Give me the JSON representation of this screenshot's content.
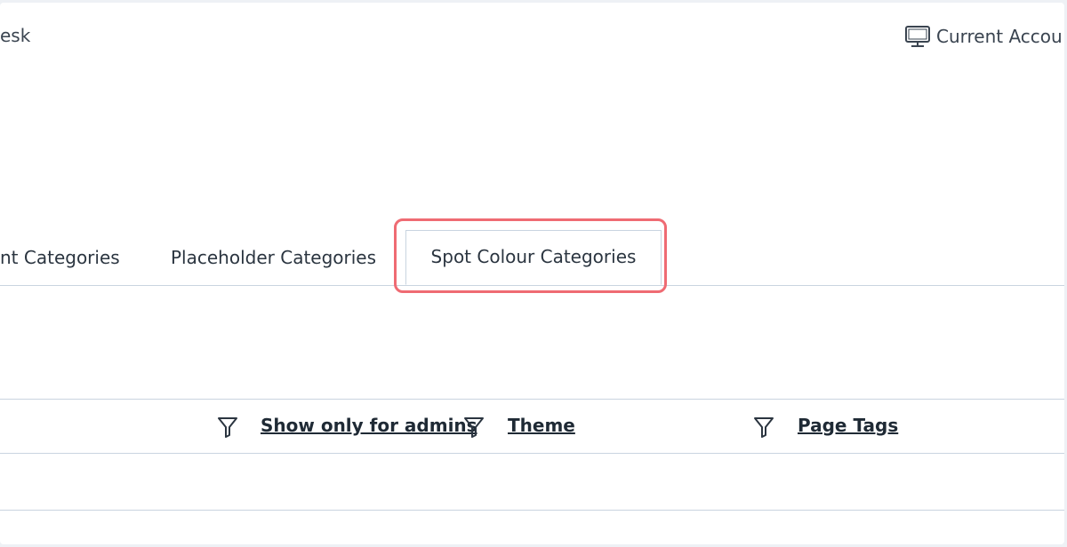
{
  "topbar": {
    "left_text": "esk",
    "account_label": "Current Accou",
    "account_icon": "monitor-icon"
  },
  "tabs": [
    {
      "label": "nt Categories",
      "active": false
    },
    {
      "label": "Placeholder Categories",
      "active": false
    },
    {
      "label": "Spot Colour Categories",
      "active": true
    }
  ],
  "table": {
    "columns": [
      {
        "label": "Show only for admins",
        "filter_icon": "filter-icon"
      },
      {
        "label": "Theme",
        "filter_icon": "filter-icon"
      },
      {
        "label": "Page Tags",
        "filter_icon": "filter-icon"
      }
    ]
  },
  "colors": {
    "highlight": "#ef6b73",
    "border": "#c9d4e0",
    "text": "#1f2a35"
  }
}
